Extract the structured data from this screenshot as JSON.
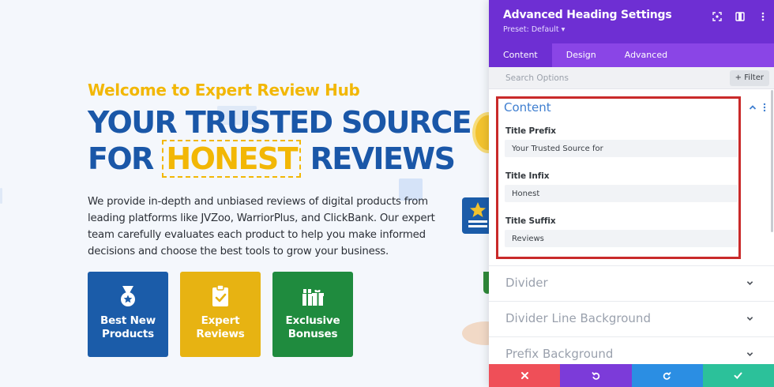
{
  "page": {
    "eyebrow": "Welcome to Expert Review Hub",
    "headline_line1": "YOUR TRUSTED SOURCE",
    "headline_line2_pre": "FOR",
    "headline_highlight": "HONEST",
    "headline_line2_post": "REVIEWS",
    "description": "We provide in-depth and unbiased reviews of digital products from leading platforms like JVZoo, WarriorPlus, and ClickBank. Our expert team carefully evaluates each product to help you make informed decisions and choose the best tools to grow your business.",
    "cards": [
      {
        "line1": "Best New",
        "line2": "Products",
        "icon": "medal-icon",
        "color": "#1b5ca9"
      },
      {
        "line1": "Expert",
        "line2": "Reviews",
        "icon": "clipboard-check-icon",
        "color": "#e7b312"
      },
      {
        "line1": "Exclusive",
        "line2": "Bonuses",
        "icon": "gift-icon",
        "color": "#1f8b3e"
      }
    ]
  },
  "panel": {
    "title": "Advanced Heading Settings",
    "preset": "Preset: Default ▾",
    "tabs": [
      "Content",
      "Design",
      "Advanced"
    ],
    "active_tab": "Content",
    "search_placeholder": "Search Options",
    "filter_label": "+ Filter",
    "section_title": "Content",
    "fields": [
      {
        "label": "Title Prefix",
        "value": "Your Trusted Source for"
      },
      {
        "label": "Title Infix",
        "value": "Honest"
      },
      {
        "label": "Title Suffix",
        "value": "Reviews"
      }
    ],
    "collapsed_sections": [
      "Divider",
      "Divider Line Background",
      "Prefix Background"
    ],
    "footer_buttons": [
      "discard-icon",
      "undo-icon",
      "redo-icon",
      "save-icon"
    ],
    "colors": {
      "header": "#6e2fd3",
      "tabs": "#8a45e6",
      "highlight_border": "#c92a2a",
      "discard": "#ef4f58",
      "undo": "#7c3bd9",
      "redo": "#2b8ee3",
      "save": "#2cc19a"
    }
  }
}
